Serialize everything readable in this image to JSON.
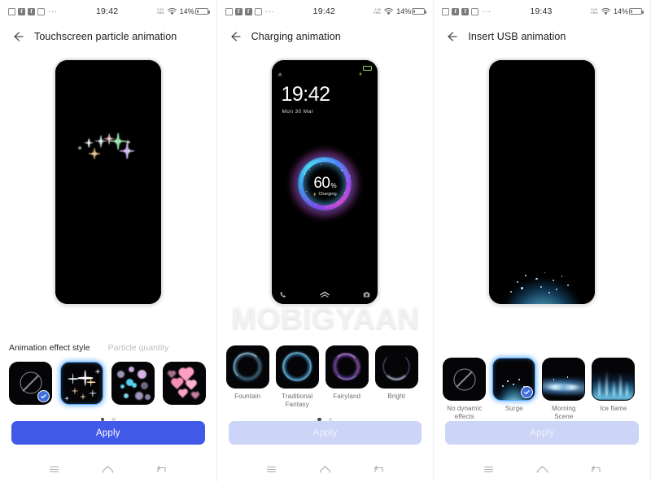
{
  "watermark": "MOBIGYAAN",
  "screens": [
    {
      "id": "touchscreen-particle-animation",
      "statusbar": {
        "time": "19:42",
        "battery_percent": "14%",
        "speed_top": "0.20",
        "speed_bottom": "KB/s",
        "overflow_dots": "···",
        "icons": [
          "sim-icon",
          "facebook-icon",
          "facebook-icon",
          "mail-icon",
          "wifi-icon",
          "battery-icon"
        ]
      },
      "appbar": {
        "title": "Touchscreen particle animation",
        "back": "back-arrow-icon"
      },
      "tabs": [
        {
          "label": "Animation effect style",
          "active": true
        },
        {
          "label": "Particle quantity",
          "active": false
        }
      ],
      "thumbnails": [
        {
          "label": "",
          "style": "none",
          "selected": false,
          "checked": true
        },
        {
          "label": "",
          "style": "sparkle",
          "selected": true,
          "checked": false
        },
        {
          "label": "",
          "style": "bubbles",
          "selected": false,
          "checked": false
        },
        {
          "label": "",
          "style": "hearts",
          "selected": false,
          "checked": false
        }
      ],
      "dots": [
        true,
        false
      ],
      "apply": {
        "label": "Apply",
        "enabled": true
      },
      "navbar": [
        "recents-icon",
        "home-icon",
        "back-icon"
      ]
    },
    {
      "id": "charging-animation",
      "statusbar": {
        "time": "19:42",
        "battery_percent": "14%",
        "speed_top": "1.50",
        "speed_bottom": "KB/s",
        "overflow_dots": "···",
        "icons": [
          "sim-icon",
          "facebook-icon",
          "facebook-icon",
          "mail-icon",
          "wifi-icon",
          "battery-icon"
        ]
      },
      "appbar": {
        "title": "Charging animation",
        "back": "back-arrow-icon"
      },
      "lockscreen": {
        "clock": "19:42",
        "date": "Mon  30 Mar",
        "charge_percent": "60",
        "percent_symbol": "%",
        "charge_status": "Charging",
        "bottom_icons": [
          "phone-icon",
          "chevron-double-up-icon",
          "camera-icon"
        ]
      },
      "thumbnails": [
        {
          "label": "Fountain",
          "style": "ring-fountain",
          "selected": false,
          "checked": false
        },
        {
          "label": "Traditional Fantasy",
          "style": "ring-traditional",
          "selected": false,
          "checked": false
        },
        {
          "label": "Fairyland",
          "style": "ring-fairyland",
          "selected": false,
          "checked": false
        },
        {
          "label": "Bright",
          "style": "ring-bright",
          "selected": false,
          "checked": false
        }
      ],
      "dots": [
        true,
        false
      ],
      "apply": {
        "label": "Apply",
        "enabled": false
      },
      "navbar": [
        "recents-icon",
        "home-icon",
        "back-icon"
      ]
    },
    {
      "id": "insert-usb-animation",
      "statusbar": {
        "time": "19:43",
        "battery_percent": "14%",
        "speed_top": "0.00",
        "speed_bottom": "KB/s",
        "overflow_dots": "···",
        "icons": [
          "sim-icon",
          "facebook-icon",
          "facebook-icon",
          "mail-icon",
          "wifi-icon",
          "battery-icon"
        ]
      },
      "appbar": {
        "title": "Insert USB animation",
        "back": "back-arrow-icon"
      },
      "thumbnails": [
        {
          "label": "No dynamic effects",
          "style": "none",
          "selected": false,
          "checked": false
        },
        {
          "label": "Surge",
          "style": "surge",
          "selected": true,
          "checked": true
        },
        {
          "label": "Morning Scene",
          "style": "morning",
          "selected": false,
          "checked": false
        },
        {
          "label": "Ice flame",
          "style": "iceflame",
          "selected": false,
          "checked": false
        }
      ],
      "apply": {
        "label": "Apply",
        "enabled": false
      },
      "navbar": [
        "recents-icon",
        "home-icon",
        "back-icon"
      ]
    }
  ],
  "colors": {
    "accent_blue": "#4059e8",
    "disabled_blue": "#ccd4f7",
    "selection_glow": "#56a8ff",
    "check_badge": "#3f6fe0"
  }
}
